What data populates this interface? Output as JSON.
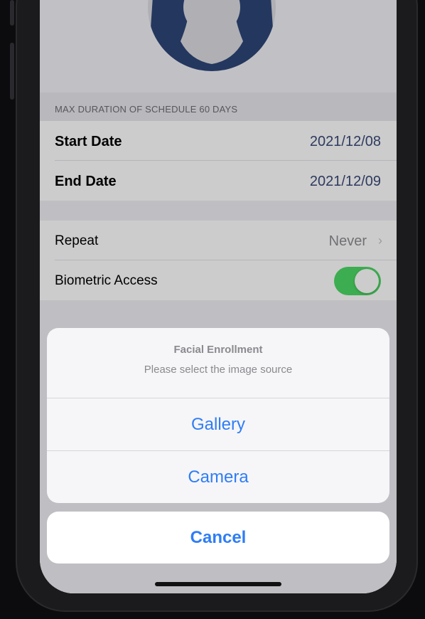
{
  "section": {
    "header": "MAX DURATION OF SCHEDULE 60 DAYS"
  },
  "dates": {
    "start_label": "Start Date",
    "start_value": "2021/12/08",
    "end_label": "End Date",
    "end_value": "2021/12/09"
  },
  "settings": {
    "repeat_label": "Repeat",
    "repeat_value": "Never",
    "biometric_label": "Biometric Access",
    "biometric_enabled": true
  },
  "action_sheet": {
    "title": "Facial Enrollment",
    "message": "Please select the image source",
    "options": [
      "Gallery",
      "Camera"
    ],
    "cancel_label": "Cancel"
  },
  "icons": {
    "avatar": "person-silhouette-icon",
    "chevron": "chevron-right-icon"
  },
  "colors": {
    "accent": "#2f7df6",
    "toggle_on": "#4cd964",
    "date_value": "#3a4a78"
  }
}
